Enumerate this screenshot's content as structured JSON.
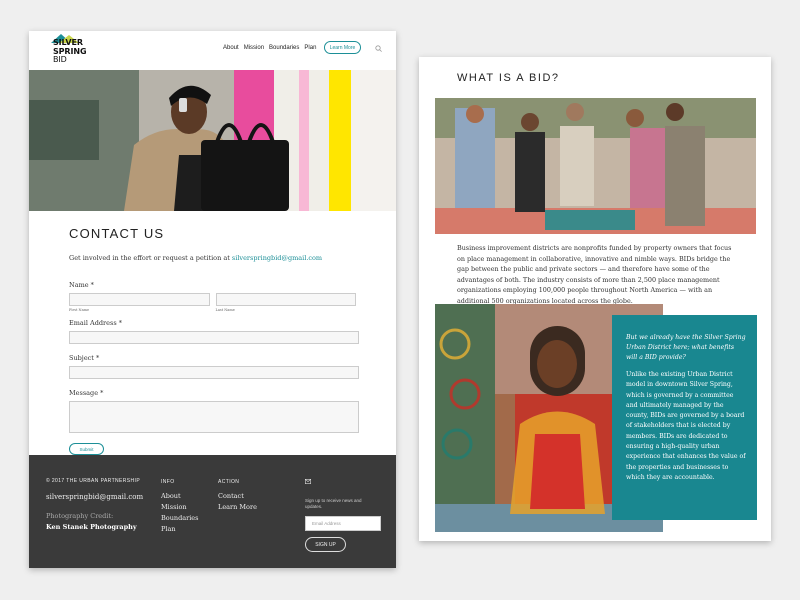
{
  "contact_page": {
    "logo": {
      "line1": "SILVER",
      "line2": "SPRING",
      "line3": "BID"
    },
    "nav": {
      "links": [
        "About",
        "Mission",
        "Boundaries",
        "Plan"
      ],
      "cta_label": "Learn More",
      "search_icon": "search-icon"
    },
    "colors": {
      "accent": "#1c8f97",
      "footer_bg": "#3a3a3a"
    },
    "contact": {
      "title": "CONTACT US",
      "intro_text": "Get involved in the effort or request a petition at ",
      "intro_email": "silverspringbid@gmail.com",
      "name_label": "Name *",
      "first_name_sub": "First Name",
      "last_name_sub": "Last Name",
      "email_label": "Email Address *",
      "subject_label": "Subject *",
      "message_label": "Message *",
      "submit_label": "Submit"
    },
    "footer": {
      "copyright": "© 2017 THE URBAN PARTNERSHIP",
      "email": "silverspringbid@gmail.com",
      "credit_label": "Photography Credit:",
      "credit_name": "Ken Stanek Photography",
      "info_heading": "INFO",
      "info_links": [
        "About",
        "Mission",
        "Boundaries",
        "Plan"
      ],
      "action_heading": "ACTION",
      "action_links": [
        "Contact",
        "Learn More"
      ],
      "newsletter_icon": "mail-icon",
      "newsletter_text": "Sign up to receive news and updates.",
      "newsletter_placeholder": "Email Address",
      "signup_label": "SIGN UP"
    }
  },
  "about_page": {
    "title": "WHAT IS A BID?",
    "body": "Business improvement districts are nonprofits funded by property owners that focus on place management in collaborative, innovative and nimble ways. BIDs bridge the gap between the public and private sectors — and therefore have some of the advantages of both. The industry consists of more than 2,500 place management organizations employing 100,000 people throughout North America — with an additional 500 organizations located across the globe.",
    "card_question": "But we already have the Silver Spring Urban District here; what benefits will a BID provide?",
    "card_text": "Unlike the existing Urban District model in downtown Silver Spring, which is governed by a committee and ultimately managed by the county, BIDs are governed by a board of stakeholders that is elected by members. BIDs are dedicated to ensuring a high-quality urban experience that enhances the value of the properties and businesses to which they are accountable.",
    "colors": {
      "card_bg": "#198790"
    }
  }
}
